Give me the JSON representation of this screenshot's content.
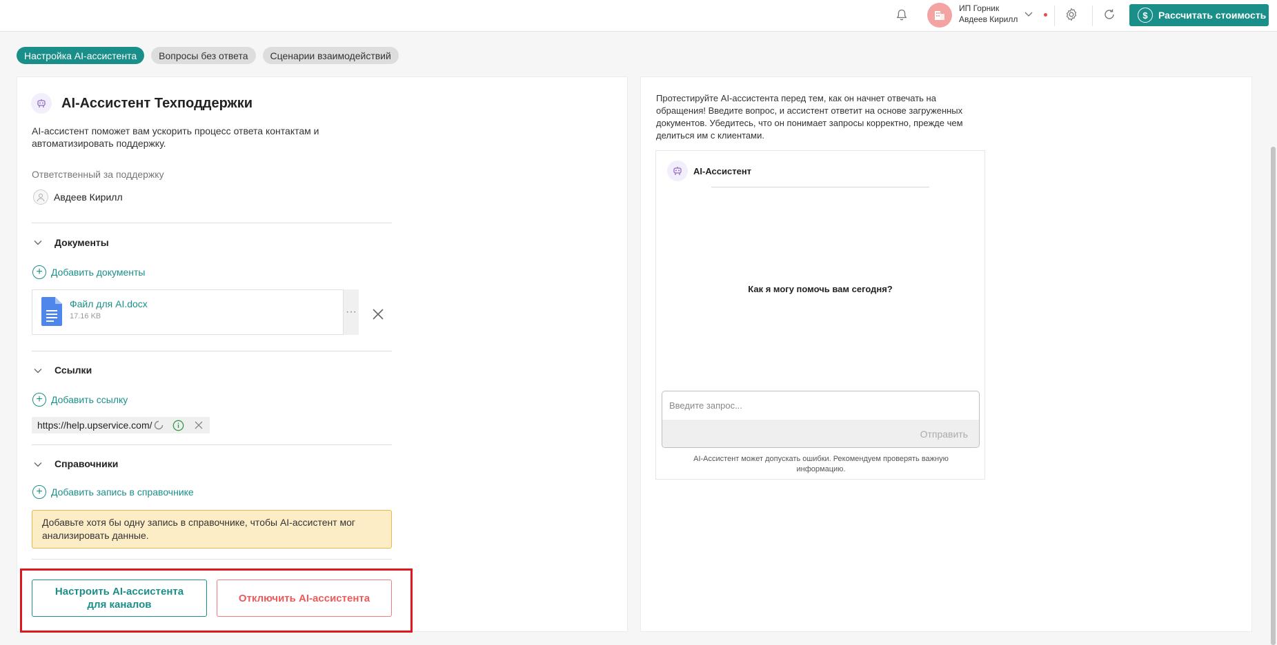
{
  "header": {
    "company": "ИП Горник",
    "user": "Авдеев Кирилл",
    "calc_button": "Рассчитать стоимость",
    "calc_icon": "$"
  },
  "tabs": [
    {
      "label": "Настройка AI-ассистента",
      "active": true
    },
    {
      "label": "Вопросы без ответа",
      "active": false
    },
    {
      "label": "Сценарии взаимодействий",
      "active": false
    }
  ],
  "assistant": {
    "title": "AI-Ассистент Техподдержки",
    "description": "AI-ассистент поможет вам ускорить процесс ответа контактам и автоматизировать поддержку.",
    "responsible_label": "Ответственный за поддержку",
    "responsible_name": "Авдеев Кирилл"
  },
  "documents": {
    "section_title": "Документы",
    "add_label": "Добавить документы",
    "files": [
      {
        "name": "Файл для AI.docx",
        "size": "17.16 KB"
      }
    ],
    "more": "···"
  },
  "links": {
    "section_title": "Ссылки",
    "add_label": "Добавить ссылку",
    "items": [
      {
        "url": "https://help.upservice.com/"
      }
    ]
  },
  "directories": {
    "section_title": "Справочники",
    "add_label": "Добавить запись в справочнике",
    "warning": "Добавьте хотя бы одну запись в справочнике, чтобы AI-ассистент мог анализировать данные."
  },
  "actions": {
    "configure": "Настроить AI-ассистента для каналов",
    "disable": "Отключить AI-ассистента"
  },
  "test_panel": {
    "intro": "Протестируйте AI-ассистента перед тем, как он начнет отвечать на обращения! Введите вопрос, и ассистент ответит на основе загруженных документов. Убедитесь, что он понимает запросы корректно, прежде чем делиться им с клиентами.",
    "chat_title": "AI-Ассистент",
    "greeting": "Как я могу помочь вам сегодня?",
    "input_placeholder": "Введите запрос...",
    "send_label": "Отправить",
    "disclaimer": "AI-Ассистент может допускать ошибки. Рекомендуем проверять важную информацию."
  },
  "colors": {
    "accent": "#1a8f8a",
    "danger": "#ee5a5a",
    "warning_bg": "#fdedc7",
    "highlight_frame": "#e0161f"
  }
}
